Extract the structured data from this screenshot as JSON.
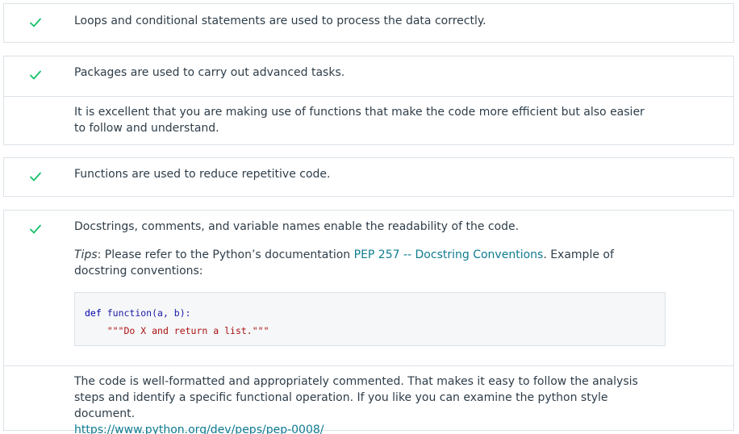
{
  "criteria": [
    {
      "text": "Loops and conditional statements are used to process the data correctly.",
      "status_icon": "check-icon"
    },
    {
      "text": "Packages are used to carry out advanced tasks.",
      "status_icon": "check-icon",
      "reviewer_note": "It is excellent that you are making use of functions that make the code more efficient but also easier to follow and understand."
    },
    {
      "text": "Functions are used to reduce repetitive code.",
      "status_icon": "check-icon"
    },
    {
      "text": "Docstrings, comments, and variable names enable the readability of the code.",
      "status_icon": "check-icon",
      "tips": {
        "label": "Tips",
        "before": ": Please refer to the Python’s documentation ",
        "link_text": "PEP 257 -- Docstring Conventions",
        "after": ". Example of docstring conventions:"
      },
      "code": {
        "line1_kw": "def",
        "line1_fn": "function",
        "line1_rest": "(a, b):",
        "line2_indent": "    ",
        "line2_str": "\"\"\"Do X and return a list.\"\"\""
      },
      "reviewer_note": "The code is well-formatted and appropriately commented. That makes it easy to follow the analysis steps and identify a specific functional operation. If you like you can examine the python style document.",
      "reviewer_link": "https://www.python.org/dev/peps/pep-0008/"
    }
  ],
  "colors": {
    "check": "#02b3e4",
    "check_green": "#15c26b",
    "link": "#0f7c90",
    "border": "#dbe2e8"
  }
}
